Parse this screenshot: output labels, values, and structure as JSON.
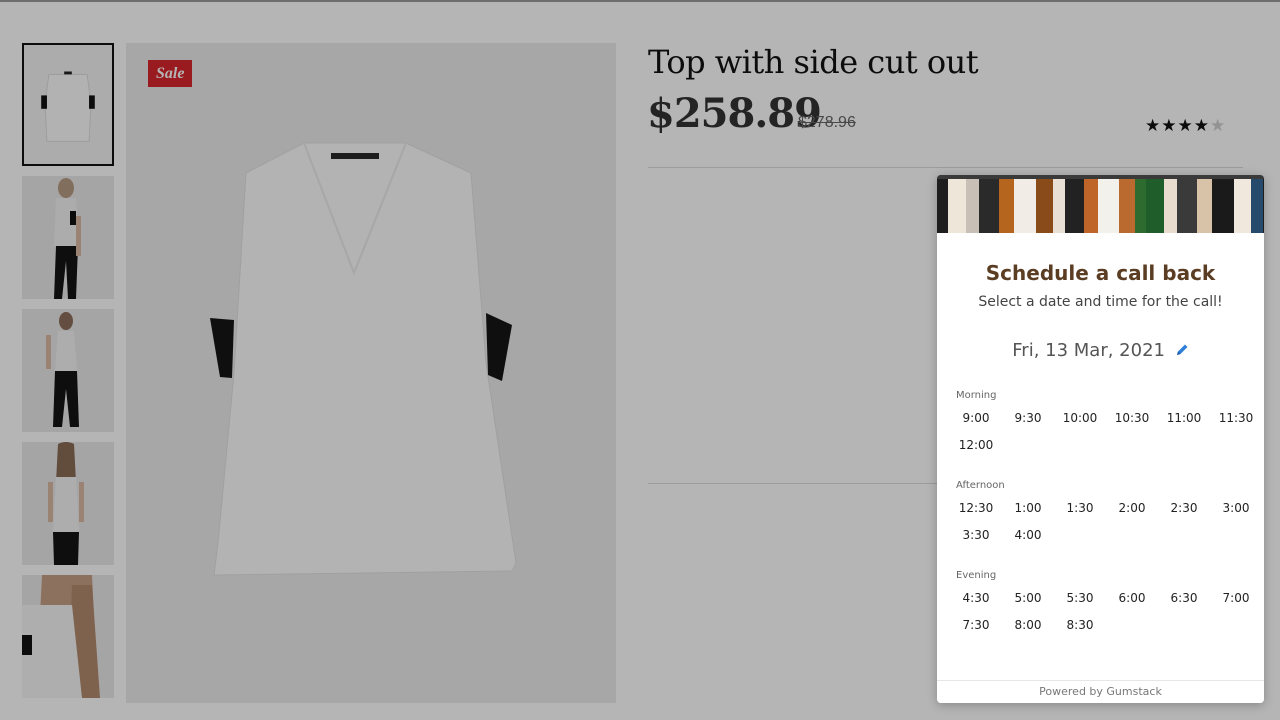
{
  "product": {
    "sale_badge": "Sale",
    "title": "Top with side cut out",
    "price": "$258.89",
    "old_price": "$278.96",
    "rating": 4,
    "rating_max": 5
  },
  "thumbnails": [
    {
      "label": "front flat view"
    },
    {
      "label": "model side view"
    },
    {
      "label": "model full front view"
    },
    {
      "label": "model back view"
    },
    {
      "label": "model close-up view"
    }
  ],
  "widget": {
    "title": "Schedule a call back",
    "subtitle": "Select a date and time for the call!",
    "date": "Fri, 13 Mar, 2021",
    "periods": [
      {
        "label": "Morning",
        "slots": [
          "9:00",
          "9:30",
          "10:00",
          "10:30",
          "11:00",
          "11:30",
          "12:00"
        ]
      },
      {
        "label": "Afternoon",
        "slots": [
          "12:30",
          "1:00",
          "1:30",
          "2:00",
          "2:30",
          "3:00",
          "3:30",
          "4:00"
        ]
      },
      {
        "label": "Evening",
        "slots": [
          "4:30",
          "5:00",
          "5:30",
          "6:00",
          "6:30",
          "7:00",
          "7:30",
          "8:00",
          "8:30"
        ]
      }
    ],
    "footer": "Powered by Gumstack"
  },
  "colors": {
    "sale": "#d9262c",
    "widget_title": "#5a3d22",
    "pencil": "#2f7fd8",
    "overlay": "rgba(0,0,0,0.29)"
  },
  "icons": {
    "edit": "pencil-icon",
    "rating": "star-icon"
  }
}
